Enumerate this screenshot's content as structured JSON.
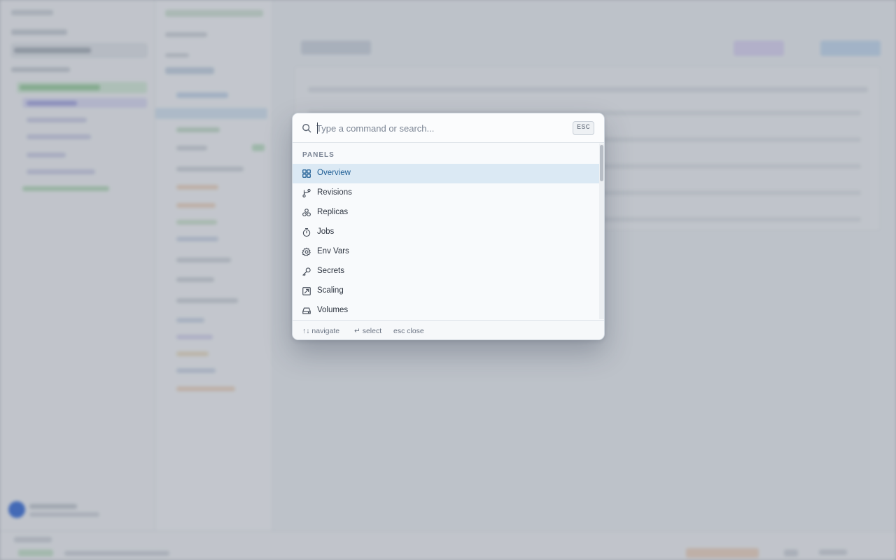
{
  "palette": {
    "placeholder": "Type a command or search...",
    "esc_label": "ESC",
    "section_title": "PANELS",
    "items": [
      {
        "label": "Overview",
        "icon": "grid-icon",
        "active": true
      },
      {
        "label": "Revisions",
        "icon": "git-branch-icon",
        "active": false
      },
      {
        "label": "Replicas",
        "icon": "layers-icon",
        "active": false
      },
      {
        "label": "Jobs",
        "icon": "timer-icon",
        "active": false
      },
      {
        "label": "Env Vars",
        "icon": "gear-icon",
        "active": false
      },
      {
        "label": "Secrets",
        "icon": "key-icon",
        "active": false
      },
      {
        "label": "Scaling",
        "icon": "scale-icon",
        "active": false
      },
      {
        "label": "Volumes",
        "icon": "drive-icon",
        "active": false
      }
    ],
    "footer": {
      "navigate": "↑↓ navigate",
      "select": "↵ select",
      "close": "esc close"
    }
  },
  "colors": {
    "accent": "#1d5d94",
    "active_row": "#dbe9f4",
    "overlay": "#c4c7cc"
  }
}
